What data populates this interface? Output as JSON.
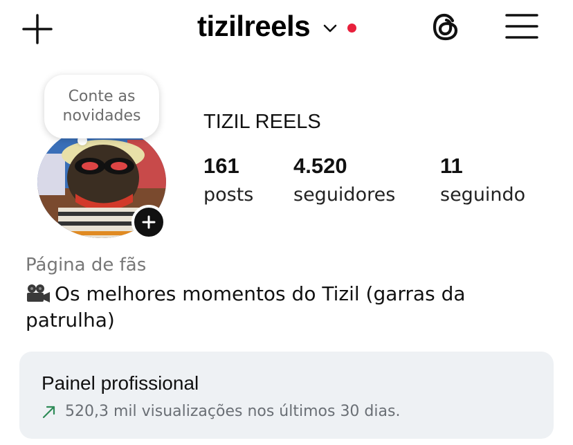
{
  "header": {
    "username": "tizilreels",
    "notification_dot_color": "#e8203c",
    "icons": [
      "plus-icon",
      "chevron-down-icon",
      "threads-icon",
      "hamburger-menu-icon"
    ]
  },
  "note": {
    "text": "Conte as novidades"
  },
  "profile": {
    "display_name": "TIZIL REELS",
    "stats": {
      "posts": {
        "value": "161",
        "label": "posts"
      },
      "followers": {
        "value": "4.520",
        "label": "seguidores"
      },
      "following": {
        "value": "11",
        "label": "seguindo"
      }
    }
  },
  "bio": {
    "category": "Página de fãs",
    "icon": "movie-camera-icon",
    "text": "Os melhores momentos do Tizil (garras da patrulha)"
  },
  "dashboard": {
    "title": "Painel profissional",
    "trend_icon": "trend-up-arrow-icon",
    "trend_color": "#2e8b57",
    "subtitle": "520,3 mil visualizações nos últimos 30 dias."
  }
}
